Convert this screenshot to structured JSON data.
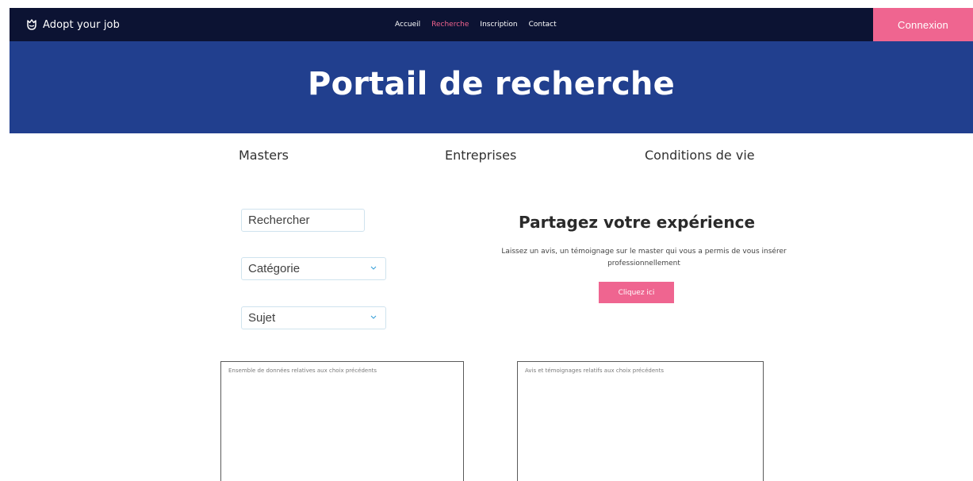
{
  "brand": {
    "name": "Adopt your job"
  },
  "nav": {
    "items": [
      {
        "label": "Accueil"
      },
      {
        "label": "Recherche"
      },
      {
        "label": "Inscription"
      },
      {
        "label": "Contact"
      }
    ],
    "login_label": "Connexion"
  },
  "hero": {
    "title": "Portail de recherche"
  },
  "tabs": [
    {
      "label": "Masters"
    },
    {
      "label": "Entreprises"
    },
    {
      "label": "Conditions de vie"
    }
  ],
  "filters": {
    "search_placeholder": "Rechercher",
    "category_value": "Catégorie",
    "subject_value": "Sujet"
  },
  "share": {
    "title": "Partagez votre expérience",
    "text": "Laissez un avis, un témoignage sur le master qui vous a permis de vous insérer professionnellement",
    "button_label": "Cliquez ici"
  },
  "panels": {
    "left_label": "Ensemble de données relatives aux choix précédents",
    "right_label": "Avis et témoignages relatifs aux choix précédents"
  },
  "colors": {
    "navbar": "#0c1333",
    "hero": "#213f8e",
    "accent": "#ef6590",
    "active_link": "#f0628d"
  },
  "icons": {
    "brand_icon": "tulip-icon",
    "select_chevron": "chevron-down-icon"
  }
}
